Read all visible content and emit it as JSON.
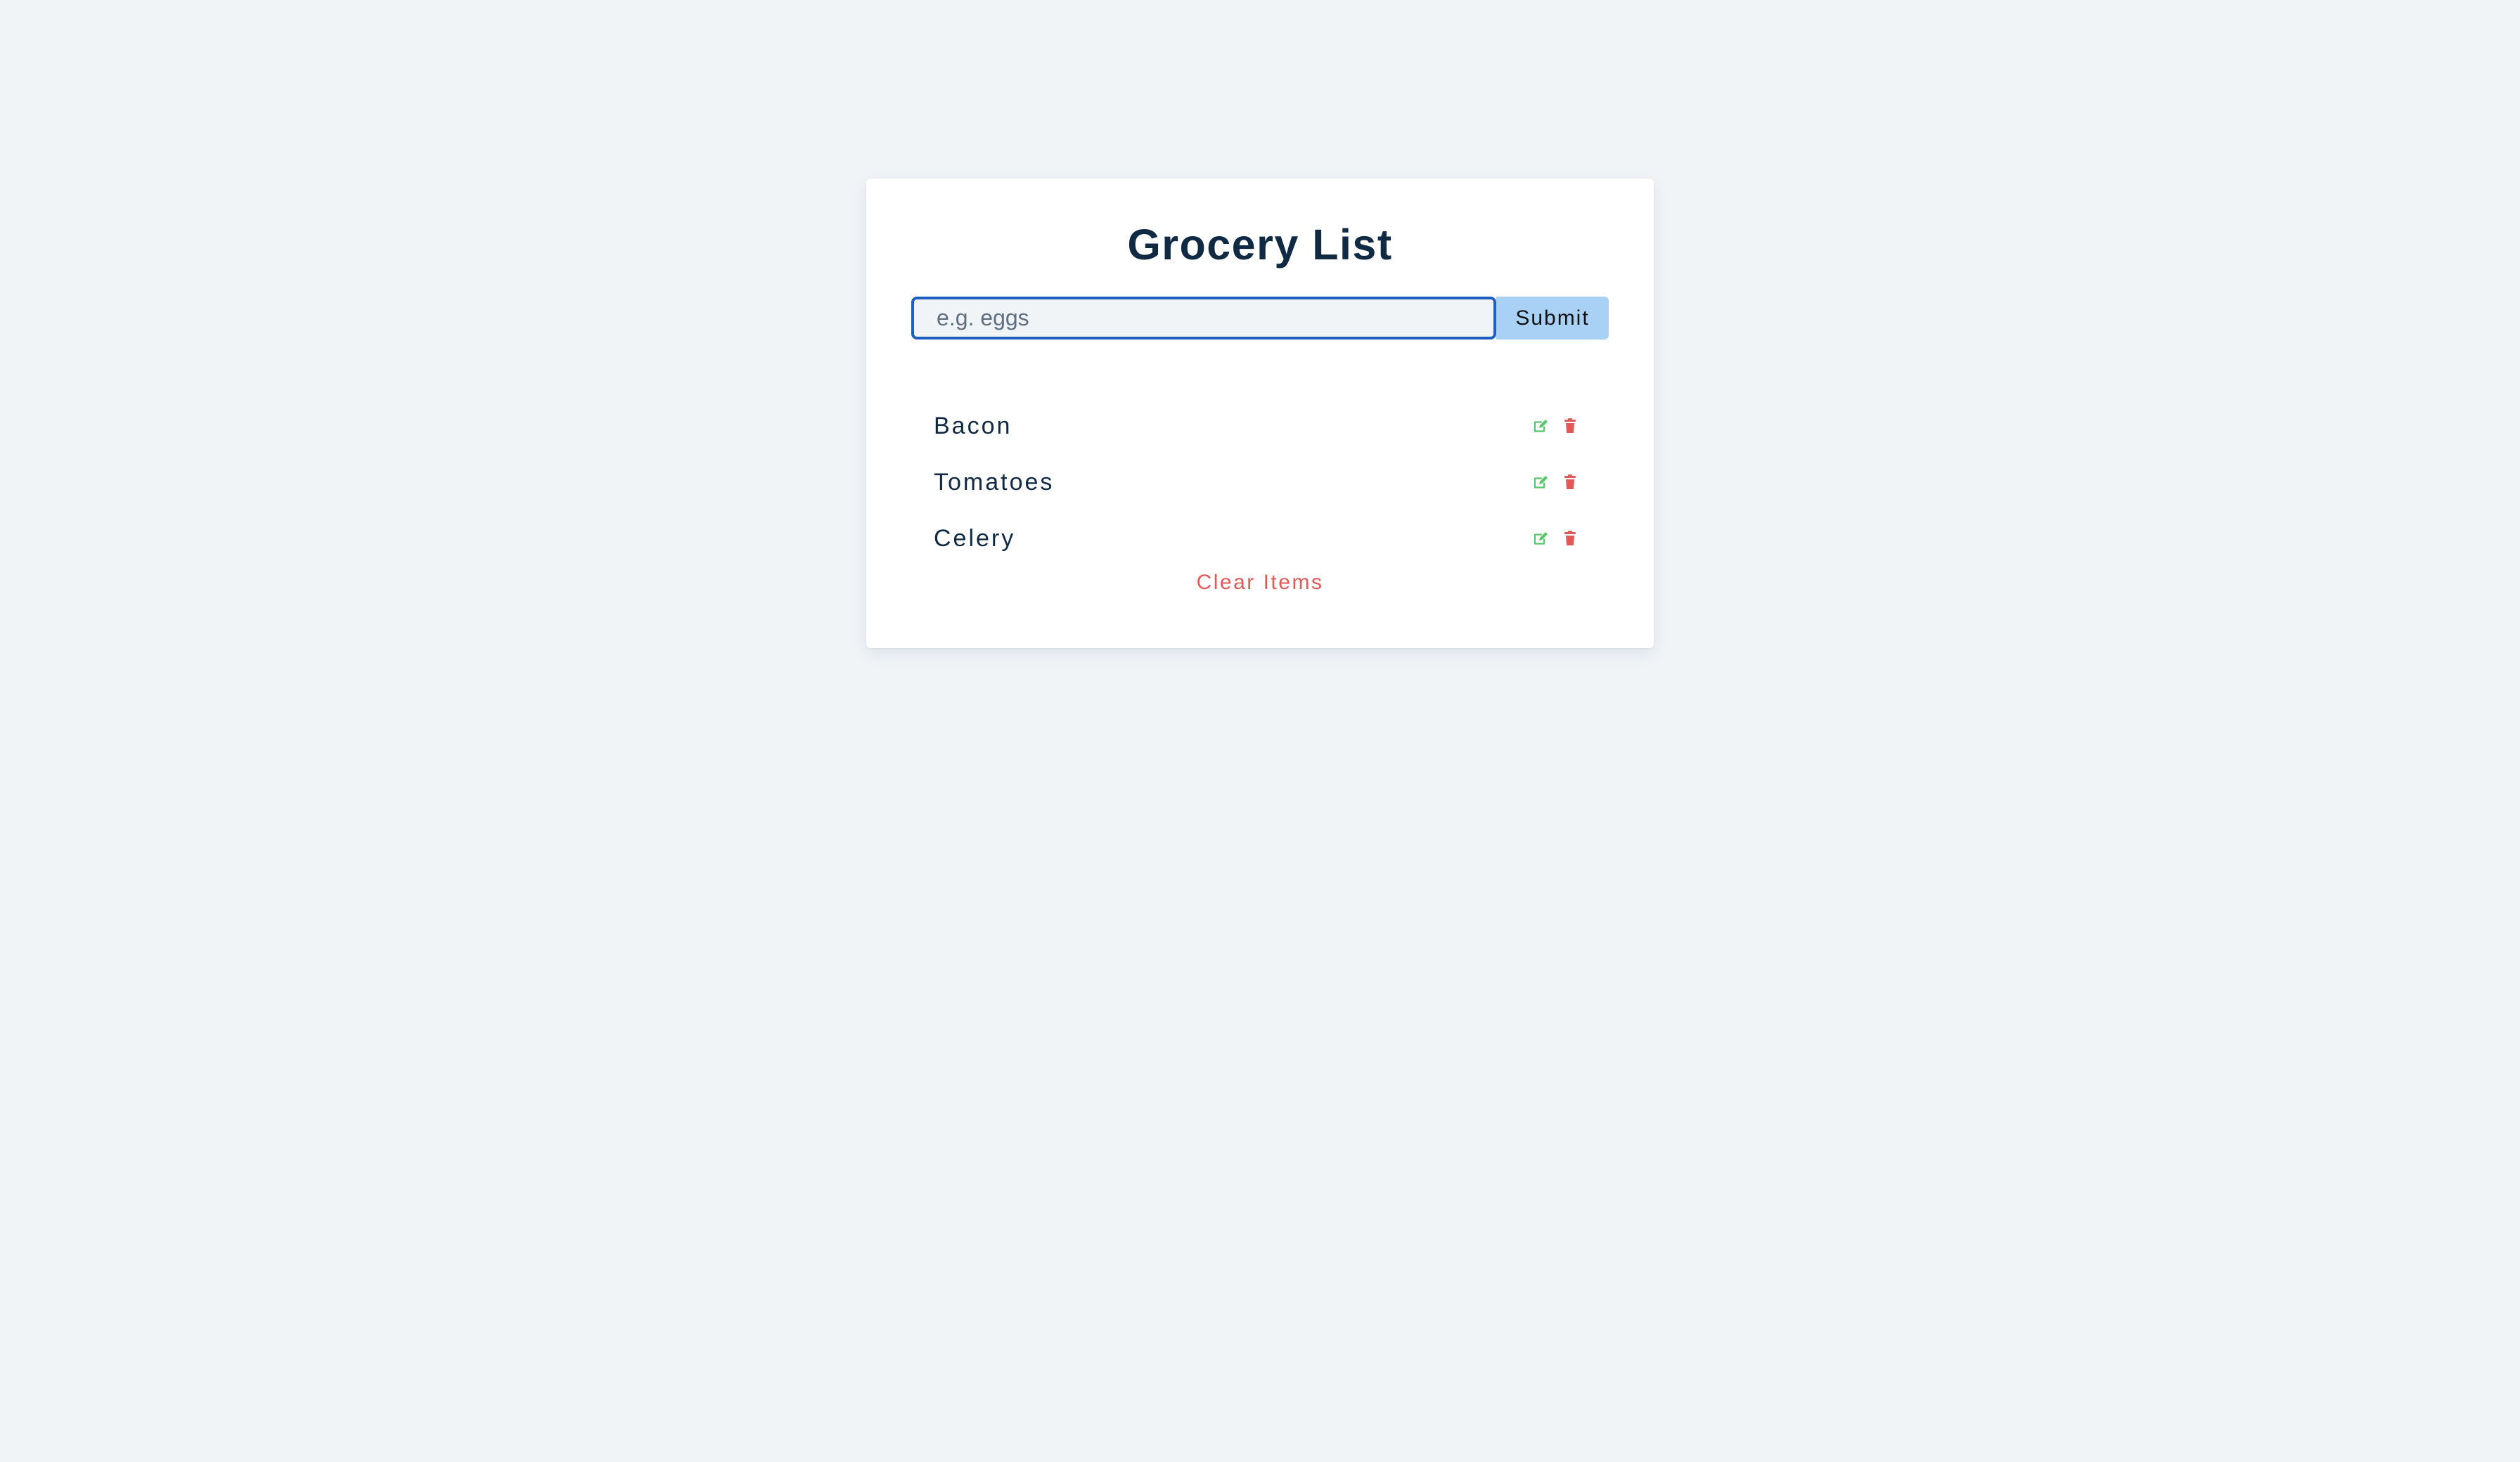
{
  "app": {
    "title": "Grocery List"
  },
  "form": {
    "placeholder": "e.g. eggs",
    "value": "",
    "submit_label": "Submit"
  },
  "items": [
    {
      "name": "Bacon"
    },
    {
      "name": "Tomatoes"
    },
    {
      "name": "Celery"
    }
  ],
  "icons": {
    "edit": "edit-icon",
    "delete": "trash-icon"
  },
  "colors": {
    "page_background": "#f0f4f7",
    "card_background": "#ffffff",
    "title": "#102a43",
    "input_border": "#1f5fbf",
    "submit_background": "#a9d0f5",
    "edit_icon": "#57c76b",
    "delete_icon": "#e05a5a",
    "clear_link": "#e05a5a"
  },
  "clear_label": "Clear Items"
}
